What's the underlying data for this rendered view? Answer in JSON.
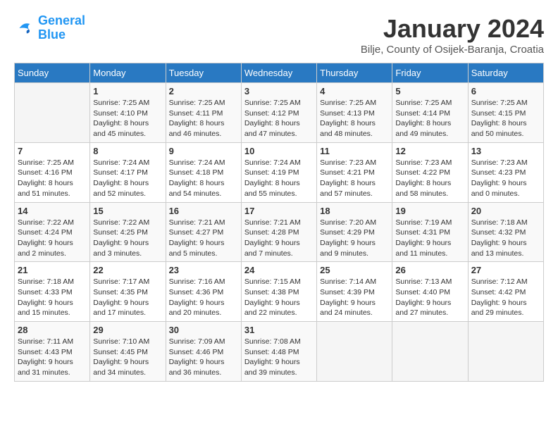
{
  "header": {
    "logo_line1": "General",
    "logo_line2": "Blue",
    "month_title": "January 2024",
    "location": "Bilje, County of Osijek-Baranja, Croatia"
  },
  "weekdays": [
    "Sunday",
    "Monday",
    "Tuesday",
    "Wednesday",
    "Thursday",
    "Friday",
    "Saturday"
  ],
  "weeks": [
    [
      {
        "day": "",
        "sunrise": "",
        "sunset": "",
        "daylight": ""
      },
      {
        "day": "1",
        "sunrise": "Sunrise: 7:25 AM",
        "sunset": "Sunset: 4:10 PM",
        "daylight": "Daylight: 8 hours and 45 minutes."
      },
      {
        "day": "2",
        "sunrise": "Sunrise: 7:25 AM",
        "sunset": "Sunset: 4:11 PM",
        "daylight": "Daylight: 8 hours and 46 minutes."
      },
      {
        "day": "3",
        "sunrise": "Sunrise: 7:25 AM",
        "sunset": "Sunset: 4:12 PM",
        "daylight": "Daylight: 8 hours and 47 minutes."
      },
      {
        "day": "4",
        "sunrise": "Sunrise: 7:25 AM",
        "sunset": "Sunset: 4:13 PM",
        "daylight": "Daylight: 8 hours and 48 minutes."
      },
      {
        "day": "5",
        "sunrise": "Sunrise: 7:25 AM",
        "sunset": "Sunset: 4:14 PM",
        "daylight": "Daylight: 8 hours and 49 minutes."
      },
      {
        "day": "6",
        "sunrise": "Sunrise: 7:25 AM",
        "sunset": "Sunset: 4:15 PM",
        "daylight": "Daylight: 8 hours and 50 minutes."
      }
    ],
    [
      {
        "day": "7",
        "sunrise": "Sunrise: 7:25 AM",
        "sunset": "Sunset: 4:16 PM",
        "daylight": "Daylight: 8 hours and 51 minutes."
      },
      {
        "day": "8",
        "sunrise": "Sunrise: 7:24 AM",
        "sunset": "Sunset: 4:17 PM",
        "daylight": "Daylight: 8 hours and 52 minutes."
      },
      {
        "day": "9",
        "sunrise": "Sunrise: 7:24 AM",
        "sunset": "Sunset: 4:18 PM",
        "daylight": "Daylight: 8 hours and 54 minutes."
      },
      {
        "day": "10",
        "sunrise": "Sunrise: 7:24 AM",
        "sunset": "Sunset: 4:19 PM",
        "daylight": "Daylight: 8 hours and 55 minutes."
      },
      {
        "day": "11",
        "sunrise": "Sunrise: 7:23 AM",
        "sunset": "Sunset: 4:21 PM",
        "daylight": "Daylight: 8 hours and 57 minutes."
      },
      {
        "day": "12",
        "sunrise": "Sunrise: 7:23 AM",
        "sunset": "Sunset: 4:22 PM",
        "daylight": "Daylight: 8 hours and 58 minutes."
      },
      {
        "day": "13",
        "sunrise": "Sunrise: 7:23 AM",
        "sunset": "Sunset: 4:23 PM",
        "daylight": "Daylight: 9 hours and 0 minutes."
      }
    ],
    [
      {
        "day": "14",
        "sunrise": "Sunrise: 7:22 AM",
        "sunset": "Sunset: 4:24 PM",
        "daylight": "Daylight: 9 hours and 2 minutes."
      },
      {
        "day": "15",
        "sunrise": "Sunrise: 7:22 AM",
        "sunset": "Sunset: 4:25 PM",
        "daylight": "Daylight: 9 hours and 3 minutes."
      },
      {
        "day": "16",
        "sunrise": "Sunrise: 7:21 AM",
        "sunset": "Sunset: 4:27 PM",
        "daylight": "Daylight: 9 hours and 5 minutes."
      },
      {
        "day": "17",
        "sunrise": "Sunrise: 7:21 AM",
        "sunset": "Sunset: 4:28 PM",
        "daylight": "Daylight: 9 hours and 7 minutes."
      },
      {
        "day": "18",
        "sunrise": "Sunrise: 7:20 AM",
        "sunset": "Sunset: 4:29 PM",
        "daylight": "Daylight: 9 hours and 9 minutes."
      },
      {
        "day": "19",
        "sunrise": "Sunrise: 7:19 AM",
        "sunset": "Sunset: 4:31 PM",
        "daylight": "Daylight: 9 hours and 11 minutes."
      },
      {
        "day": "20",
        "sunrise": "Sunrise: 7:18 AM",
        "sunset": "Sunset: 4:32 PM",
        "daylight": "Daylight: 9 hours and 13 minutes."
      }
    ],
    [
      {
        "day": "21",
        "sunrise": "Sunrise: 7:18 AM",
        "sunset": "Sunset: 4:33 PM",
        "daylight": "Daylight: 9 hours and 15 minutes."
      },
      {
        "day": "22",
        "sunrise": "Sunrise: 7:17 AM",
        "sunset": "Sunset: 4:35 PM",
        "daylight": "Daylight: 9 hours and 17 minutes."
      },
      {
        "day": "23",
        "sunrise": "Sunrise: 7:16 AM",
        "sunset": "Sunset: 4:36 PM",
        "daylight": "Daylight: 9 hours and 20 minutes."
      },
      {
        "day": "24",
        "sunrise": "Sunrise: 7:15 AM",
        "sunset": "Sunset: 4:38 PM",
        "daylight": "Daylight: 9 hours and 22 minutes."
      },
      {
        "day": "25",
        "sunrise": "Sunrise: 7:14 AM",
        "sunset": "Sunset: 4:39 PM",
        "daylight": "Daylight: 9 hours and 24 minutes."
      },
      {
        "day": "26",
        "sunrise": "Sunrise: 7:13 AM",
        "sunset": "Sunset: 4:40 PM",
        "daylight": "Daylight: 9 hours and 27 minutes."
      },
      {
        "day": "27",
        "sunrise": "Sunrise: 7:12 AM",
        "sunset": "Sunset: 4:42 PM",
        "daylight": "Daylight: 9 hours and 29 minutes."
      }
    ],
    [
      {
        "day": "28",
        "sunrise": "Sunrise: 7:11 AM",
        "sunset": "Sunset: 4:43 PM",
        "daylight": "Daylight: 9 hours and 31 minutes."
      },
      {
        "day": "29",
        "sunrise": "Sunrise: 7:10 AM",
        "sunset": "Sunset: 4:45 PM",
        "daylight": "Daylight: 9 hours and 34 minutes."
      },
      {
        "day": "30",
        "sunrise": "Sunrise: 7:09 AM",
        "sunset": "Sunset: 4:46 PM",
        "daylight": "Daylight: 9 hours and 36 minutes."
      },
      {
        "day": "31",
        "sunrise": "Sunrise: 7:08 AM",
        "sunset": "Sunset: 4:48 PM",
        "daylight": "Daylight: 9 hours and 39 minutes."
      },
      {
        "day": "",
        "sunrise": "",
        "sunset": "",
        "daylight": ""
      },
      {
        "day": "",
        "sunrise": "",
        "sunset": "",
        "daylight": ""
      },
      {
        "day": "",
        "sunrise": "",
        "sunset": "",
        "daylight": ""
      }
    ]
  ]
}
